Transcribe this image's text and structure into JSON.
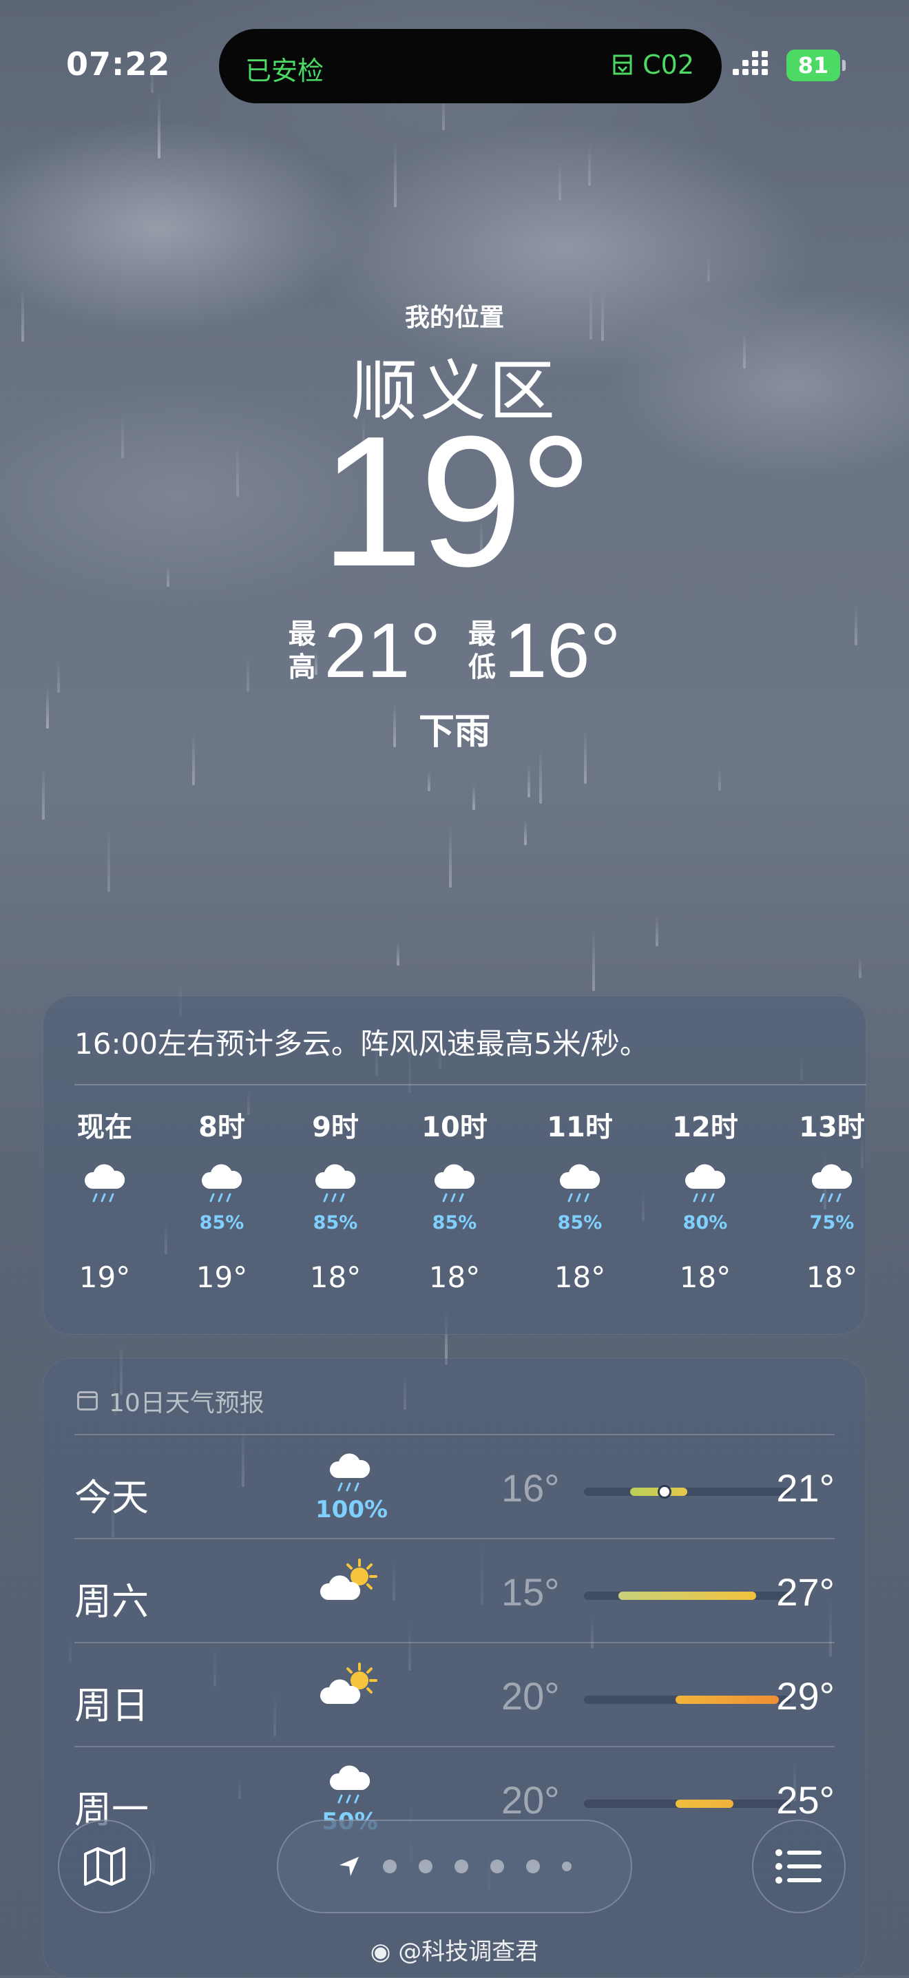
{
  "status": {
    "time": "07:22",
    "island_left": "已安检",
    "island_right": "C02",
    "battery": "81"
  },
  "header": {
    "location_label": "我的位置",
    "city": "顺义区",
    "temperature": "19°",
    "high_label_1": "最",
    "high_label_2": "高",
    "high": "21°",
    "low_label_1": "最",
    "low_label_2": "低",
    "low": "16°",
    "condition": "下雨"
  },
  "hourly": {
    "summary": "16:00左右预计多云。阵风风速最高5米/秒。",
    "items": [
      {
        "time": "现在",
        "precip": "",
        "temp": "19°",
        "icon": "rain-cloud-icon"
      },
      {
        "time": "8时",
        "precip": "85%",
        "temp": "19°",
        "icon": "rain-cloud-icon"
      },
      {
        "time": "9时",
        "precip": "85%",
        "temp": "18°",
        "icon": "rain-cloud-icon"
      },
      {
        "time": "10时",
        "precip": "85%",
        "temp": "18°",
        "icon": "rain-cloud-icon"
      },
      {
        "time": "11时",
        "precip": "85%",
        "temp": "18°",
        "icon": "rain-cloud-icon"
      },
      {
        "time": "12时",
        "precip": "80%",
        "temp": "18°",
        "icon": "rain-cloud-icon"
      },
      {
        "time": "13时",
        "precip": "75%",
        "temp": "18°",
        "icon": "rain-cloud-icon"
      }
    ]
  },
  "daily": {
    "title": "10日天气预报",
    "rows": [
      {
        "day": "今天",
        "precip": "100%",
        "low": "16°",
        "high": "21°",
        "icon": "rain-cloud-icon",
        "colors": [
          "#b9cf5a",
          "#e6c74a"
        ],
        "current": "19°"
      },
      {
        "day": "周六",
        "precip": "",
        "low": "15°",
        "high": "27°",
        "icon": "partly-sunny-icon",
        "colors": [
          "#c8d27a",
          "#f1c23d"
        ]
      },
      {
        "day": "周日",
        "precip": "",
        "low": "20°",
        "high": "29°",
        "icon": "partly-sunny-icon",
        "colors": [
          "#f1b63a",
          "#ef8f36"
        ]
      },
      {
        "day": "周一",
        "precip": "50%",
        "low": "20°",
        "high": "25°",
        "icon": "rain-cloud-icon",
        "colors": [
          "#f0be3e",
          "#f0b23c"
        ]
      }
    ]
  },
  "toolbar": {
    "map_icon": "map-icon",
    "location_icon": "location-arrow-icon",
    "list_icon": "list-icon",
    "page_dots": 7
  },
  "watermark": "@科技调查君",
  "colors": {
    "accent_green": "#4cd964",
    "precip_blue": "#7fd0ff"
  }
}
